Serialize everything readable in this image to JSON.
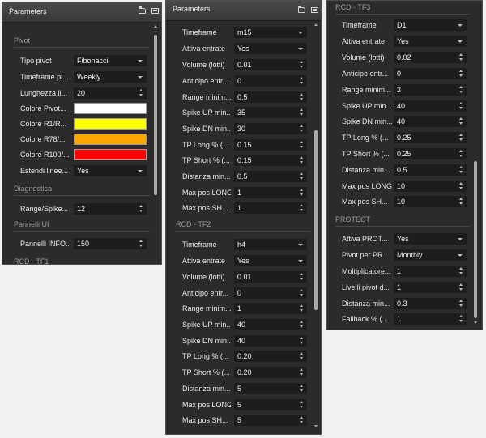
{
  "panel1": {
    "title": "Parameters",
    "sections": {
      "pivot": "Pivot",
      "diagnostica": "Diagnostica",
      "pannelli": "Pannelli UI",
      "rcd_tf1": "RCD - TF1"
    },
    "rows": [
      {
        "label": "Tipo pivot",
        "value": "Fibonacci",
        "kind": "dropdown"
      },
      {
        "label": "Timeframe pi...",
        "value": "Weekly",
        "kind": "dropdown"
      },
      {
        "label": "Lunghezza li...",
        "value": "20",
        "kind": "spinner"
      },
      {
        "label": "Colore Pivot...",
        "color": "#ffffff",
        "kind": "color"
      },
      {
        "label": "Colore R1/R...",
        "color": "#ffff00",
        "kind": "color"
      },
      {
        "label": "Colore R78/...",
        "color": "#ffa500",
        "kind": "color"
      },
      {
        "label": "Colore R100/...",
        "color": "#ff0000",
        "kind": "color"
      },
      {
        "label": "Estendi linee...",
        "value": "Yes",
        "kind": "dropdown"
      },
      {
        "label": "Range/Spike...",
        "value": "12",
        "kind": "spinner"
      },
      {
        "label": "Pannelli INFO...",
        "value": "150",
        "kind": "spinner"
      }
    ]
  },
  "panel2": {
    "title": "Parameters",
    "sections": {
      "rcd_tf2": "RCD - TF2"
    },
    "rows": [
      {
        "label": "Timeframe",
        "value": "m15",
        "kind": "dropdown"
      },
      {
        "label": "Attiva entrate",
        "value": "Yes",
        "kind": "dropdown"
      },
      {
        "label": "Volume (lotti)",
        "value": "0.01",
        "kind": "spinner"
      },
      {
        "label": "Anticipo entr...",
        "value": "0",
        "kind": "spinner"
      },
      {
        "label": "Range minim...",
        "value": "0.5",
        "kind": "spinner"
      },
      {
        "label": "Spike UP min...",
        "value": "35",
        "kind": "spinner"
      },
      {
        "label": "Spike DN min...",
        "value": "30",
        "kind": "spinner"
      },
      {
        "label": "TP Long % (...",
        "value": "0.15",
        "kind": "spinner"
      },
      {
        "label": "TP Short % (...",
        "value": "0.15",
        "kind": "spinner"
      },
      {
        "label": "Distanza min...",
        "value": "0.5",
        "kind": "spinner"
      },
      {
        "label": "Max pos LONG",
        "value": "1",
        "kind": "spinner"
      },
      {
        "label": "Max pos SH...",
        "value": "1",
        "kind": "spinner"
      },
      {
        "label": "Timeframe",
        "value": "h4",
        "kind": "dropdown"
      },
      {
        "label": "Attiva entrate",
        "value": "Yes",
        "kind": "dropdown"
      },
      {
        "label": "Volume (lotti)",
        "value": "0.01",
        "kind": "spinner"
      },
      {
        "label": "Anticipo entr...",
        "value": "0",
        "kind": "spinner"
      },
      {
        "label": "Range minim...",
        "value": "1",
        "kind": "spinner"
      },
      {
        "label": "Spike UP min...",
        "value": "40",
        "kind": "spinner"
      },
      {
        "label": "Spike DN min...",
        "value": "40",
        "kind": "spinner"
      },
      {
        "label": "TP Long % (...",
        "value": "0.20",
        "kind": "spinner"
      },
      {
        "label": "TP Short % (...",
        "value": "0.20",
        "kind": "spinner"
      },
      {
        "label": "Distanza min...",
        "value": "5",
        "kind": "spinner"
      },
      {
        "label": "Max pos LONG",
        "value": "5",
        "kind": "spinner"
      },
      {
        "label": "Max pos SH...",
        "value": "5",
        "kind": "spinner"
      }
    ]
  },
  "panel3": {
    "sections": {
      "rcd_tf3": "RCD - TF3",
      "protect": "PROTECT"
    },
    "rows": [
      {
        "label": "Timeframe",
        "value": "D1",
        "kind": "dropdown"
      },
      {
        "label": "Attiva entrate",
        "value": "Yes",
        "kind": "dropdown"
      },
      {
        "label": "Volume (lotti)",
        "value": "0.02",
        "kind": "spinner"
      },
      {
        "label": "Anticipo entr...",
        "value": "0",
        "kind": "spinner"
      },
      {
        "label": "Range minim...",
        "value": "3",
        "kind": "spinner"
      },
      {
        "label": "Spike UP min...",
        "value": "40",
        "kind": "spinner"
      },
      {
        "label": "Spike DN min...",
        "value": "40",
        "kind": "spinner"
      },
      {
        "label": "TP Long % (...",
        "value": "0.25",
        "kind": "spinner"
      },
      {
        "label": "TP Short % (...",
        "value": "0.25",
        "kind": "spinner"
      },
      {
        "label": "Distanza min...",
        "value": "0.5",
        "kind": "spinner"
      },
      {
        "label": "Max pos LONG",
        "value": "10",
        "kind": "spinner"
      },
      {
        "label": "Max pos SH...",
        "value": "10",
        "kind": "spinner"
      },
      {
        "label": "Attiva PROT...",
        "value": "Yes",
        "kind": "dropdown"
      },
      {
        "label": "Pivot per PR...",
        "value": "Monthly",
        "kind": "dropdown"
      },
      {
        "label": "Moltiplicatore...",
        "value": "1",
        "kind": "spinner"
      },
      {
        "label": "Livelli pivot d...",
        "value": "1",
        "kind": "spinner"
      },
      {
        "label": "Distanza min...",
        "value": "0.3",
        "kind": "spinner"
      },
      {
        "label": "Fallback % (...",
        "value": "1",
        "kind": "spinner"
      }
    ]
  },
  "colors": {
    "panel_bg": "#2b2b2b",
    "field_bg": "#1d1d1d",
    "titlebar": "#3f3f3f"
  },
  "icons": [
    "folder-open-icon",
    "save-icon"
  ]
}
